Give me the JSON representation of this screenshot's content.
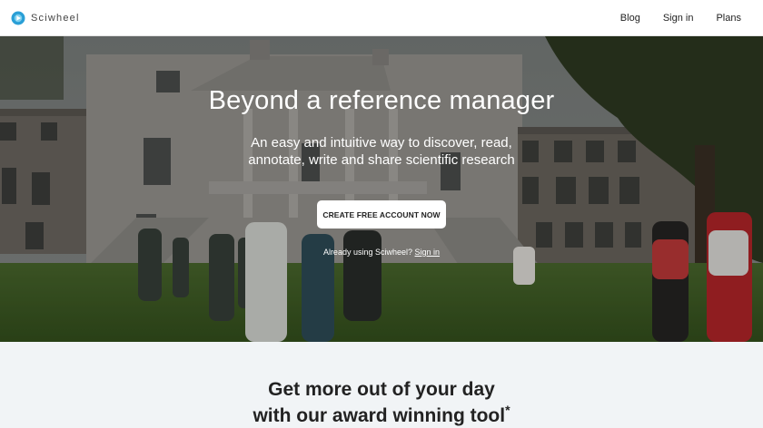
{
  "brand": {
    "name": "Sciwheel",
    "logo_icon": "sciwheel-logo-icon",
    "accent": "#2a9fd6"
  },
  "nav": {
    "items": [
      {
        "label": "Blog"
      },
      {
        "label": "Sign in"
      },
      {
        "label": "Plans"
      }
    ]
  },
  "hero": {
    "title": "Beyond a reference manager",
    "subtitle": "An easy and intuitive way to discover, read, annotate, write and share scientific research",
    "cta_label": "CREATE FREE ACCOUNT NOW",
    "signin_prompt": "Already using Sciwheel?",
    "signin_link": "Sign in"
  },
  "promo": {
    "line1": "Get more out of your day",
    "line2": "with our award winning tool",
    "footnote_mark": "*"
  }
}
